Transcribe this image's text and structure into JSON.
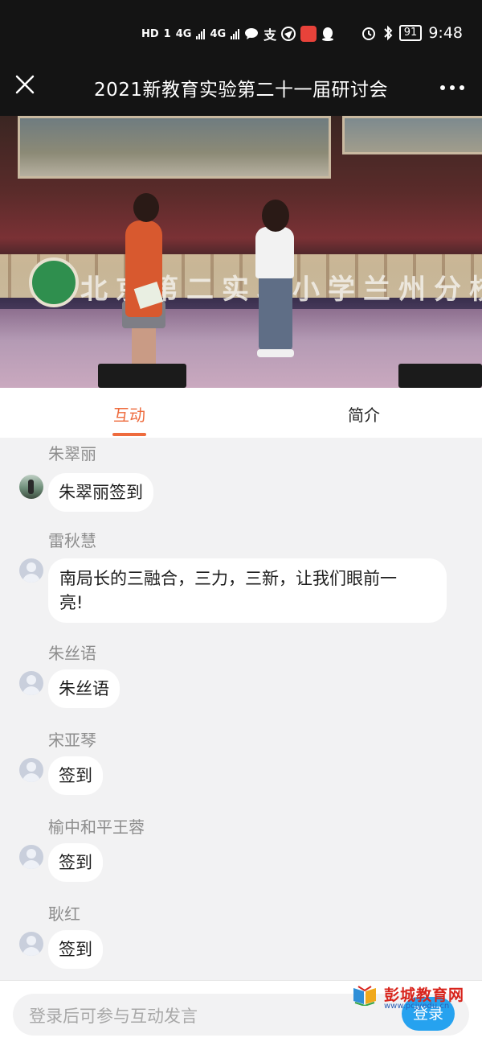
{
  "status_bar": {
    "hd_label": "HD",
    "sim1": "1",
    "net1": "4G",
    "net2": "4G",
    "alipay": "支",
    "battery": "91",
    "time": "9:48"
  },
  "header": {
    "title": "2021新教育实验第二十一届研讨会",
    "close_icon": "close-icon",
    "more_icon": "more-icon"
  },
  "video": {
    "banner_text": "北京第二实验小学兰州分校"
  },
  "tabs": [
    {
      "label": "互动",
      "active": true
    },
    {
      "label": "简介",
      "active": false
    }
  ],
  "messages": [
    {
      "name": "朱翠丽",
      "text": "朱翠丽签到",
      "avatar": "photo"
    },
    {
      "name": "雷秋慧",
      "line1": "南局长的三融合，三力，三新，让我们眼前一",
      "line2": "亮!",
      "avatar": "default"
    },
    {
      "name": "朱丝语",
      "text": "朱丝语",
      "avatar": "default"
    },
    {
      "name": "宋亚琴",
      "text": "签到",
      "avatar": "default"
    },
    {
      "name": "榆中和平王蓉",
      "text": "签到",
      "avatar": "default"
    },
    {
      "name": "耿红",
      "text": "签到",
      "avatar": "default"
    }
  ],
  "footer": {
    "placeholder": "登录后可参与互动发言",
    "login_label": "登录"
  },
  "watermark": {
    "cn": "彭城教育网",
    "en": "www.pcjyedu.cn"
  },
  "colors": {
    "accent": "#ee6b3d",
    "login": "#26a2ef",
    "header_bg": "#141414"
  }
}
